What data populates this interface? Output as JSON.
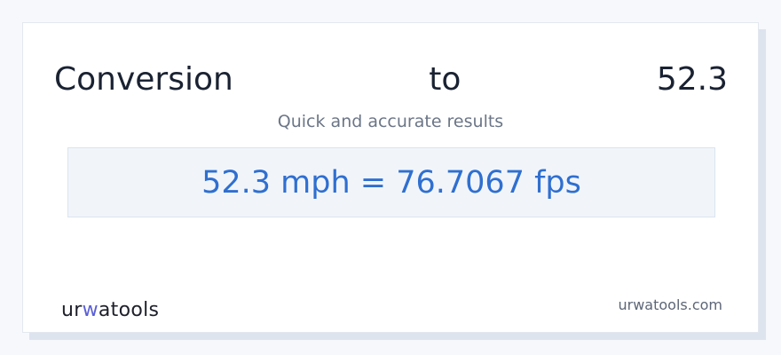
{
  "card": {
    "title_left": "Conversion",
    "title_center": "to",
    "title_right": "52.3",
    "subtitle": "Quick and accurate results",
    "result": "52.3 mph = 76.7067 fps"
  },
  "footer": {
    "logo_text_part1": "ur",
    "logo_text_accent": "w",
    "logo_text_part2": "atools",
    "site": "urwatools.com"
  },
  "colors": {
    "title": "#1a2232",
    "subtitle": "#6b7687",
    "result": "#2f6fd0",
    "result_background": "#f1f5fa",
    "logo": "#1d1f2a",
    "logo_accent": "#5a5fd6"
  }
}
